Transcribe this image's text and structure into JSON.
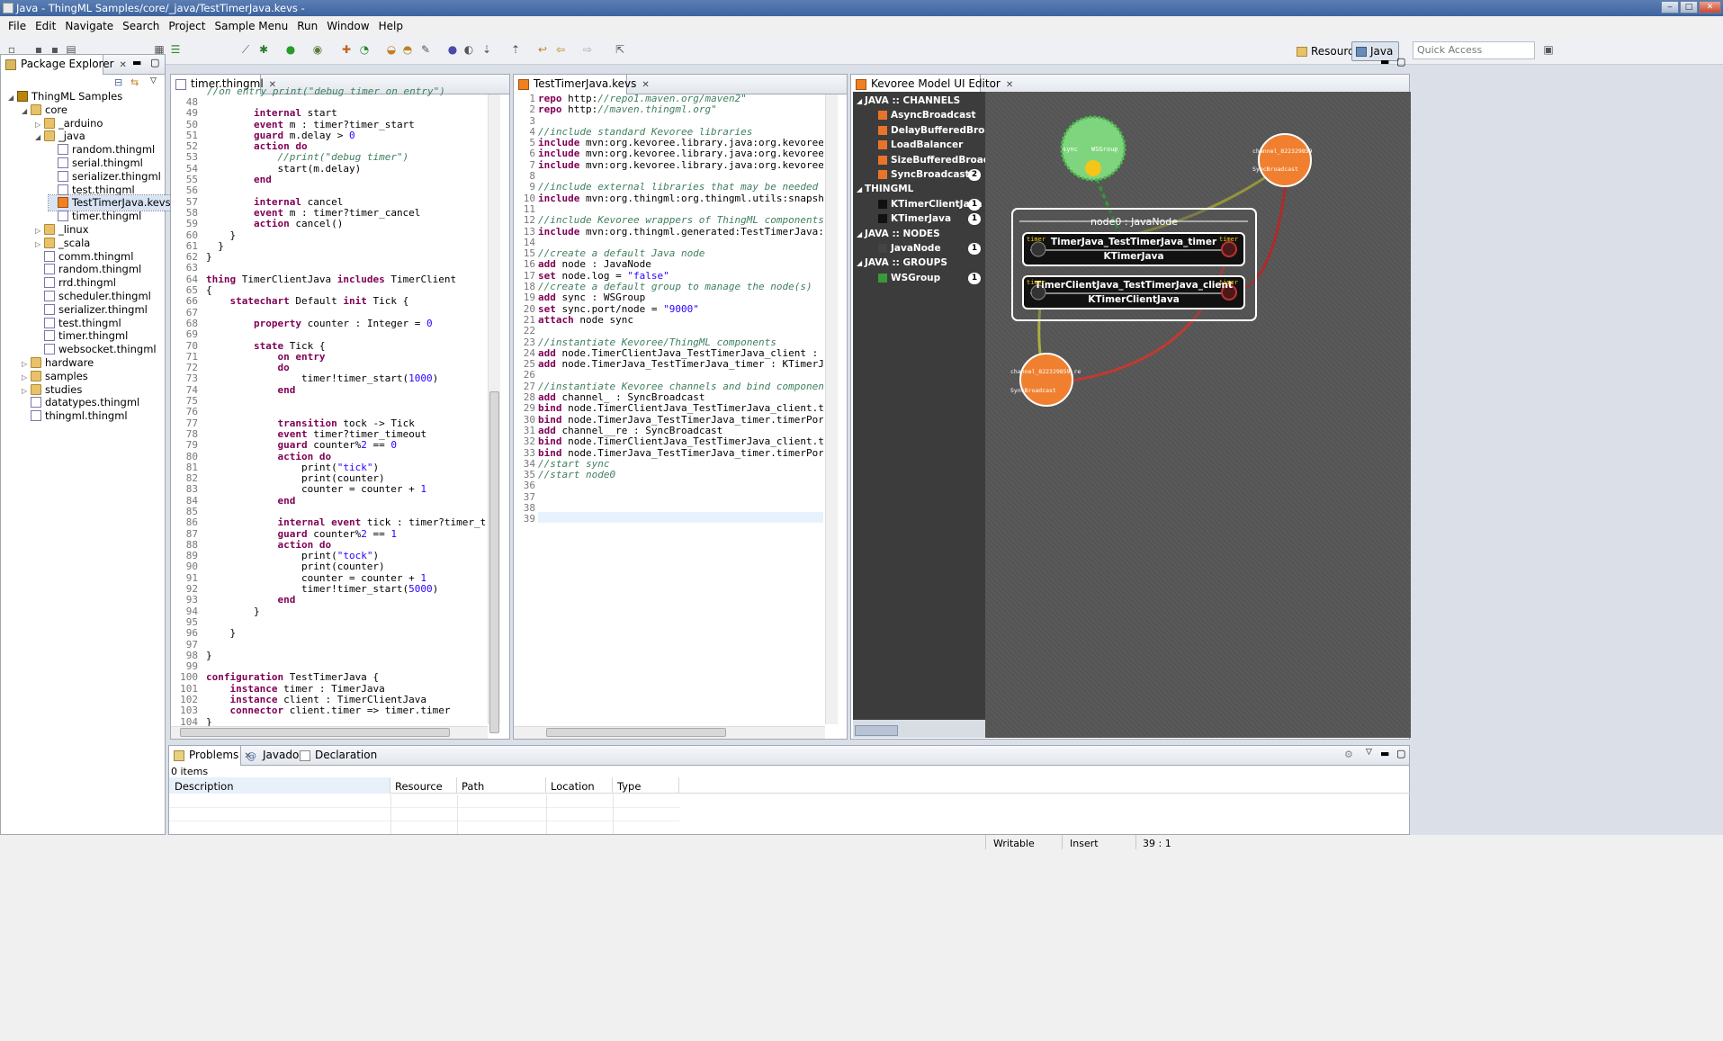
{
  "window": {
    "title": "Java - ThingML Samples/core/_java/TestTimerJava.kevs -"
  },
  "menu": [
    "File",
    "Edit",
    "Navigate",
    "Search",
    "Project",
    "Sample Menu",
    "Run",
    "Window",
    "Help"
  ],
  "toolbar": {
    "quick_access_placeholder": "Quick Access",
    "perspective_resource": "Resource",
    "perspective_java": "Java"
  },
  "package_explorer": {
    "tab_label": "Package Explorer",
    "items": [
      {
        "label": "ThingML Samples",
        "depth": 0,
        "icon": "project-icon",
        "arrow": "◢"
      },
      {
        "label": "core",
        "depth": 1,
        "icon": "folder-icon",
        "arrow": "◢"
      },
      {
        "label": "_arduino",
        "depth": 2,
        "icon": "folder-icon",
        "arrow": "▷"
      },
      {
        "label": "_java",
        "depth": 2,
        "icon": "folder-icon",
        "arrow": "◢"
      },
      {
        "label": "random.thingml",
        "depth": 3,
        "icon": "file-icon",
        "arrow": ""
      },
      {
        "label": "serial.thingml",
        "depth": 3,
        "icon": "file-icon",
        "arrow": ""
      },
      {
        "label": "serializer.thingml",
        "depth": 3,
        "icon": "file-icon",
        "arrow": ""
      },
      {
        "label": "test.thingml",
        "depth": 3,
        "icon": "file-icon",
        "arrow": ""
      },
      {
        "label": "TestTimerJava.kevs",
        "depth": 3,
        "icon": "kevs-icon",
        "arrow": ""
      },
      {
        "label": "timer.thingml",
        "depth": 3,
        "icon": "file-icon",
        "arrow": ""
      },
      {
        "label": "_linux",
        "depth": 2,
        "icon": "folder-icon",
        "arrow": "▷"
      },
      {
        "label": "_scala",
        "depth": 2,
        "icon": "folder-icon",
        "arrow": "▷"
      },
      {
        "label": "comm.thingml",
        "depth": 2,
        "icon": "file-icon",
        "arrow": ""
      },
      {
        "label": "random.thingml",
        "depth": 2,
        "icon": "file-icon",
        "arrow": ""
      },
      {
        "label": "rrd.thingml",
        "depth": 2,
        "icon": "file-icon",
        "arrow": ""
      },
      {
        "label": "scheduler.thingml",
        "depth": 2,
        "icon": "file-icon",
        "arrow": ""
      },
      {
        "label": "serializer.thingml",
        "depth": 2,
        "icon": "file-icon",
        "arrow": ""
      },
      {
        "label": "test.thingml",
        "depth": 2,
        "icon": "file-icon",
        "arrow": ""
      },
      {
        "label": "timer.thingml",
        "depth": 2,
        "icon": "file-icon",
        "arrow": ""
      },
      {
        "label": "websocket.thingml",
        "depth": 2,
        "icon": "file-icon",
        "arrow": ""
      },
      {
        "label": "hardware",
        "depth": 1,
        "icon": "folder-icon",
        "arrow": "▷"
      },
      {
        "label": "samples",
        "depth": 1,
        "icon": "folder-icon",
        "arrow": "▷"
      },
      {
        "label": "studies",
        "depth": 1,
        "icon": "folder-icon",
        "arrow": "▷"
      },
      {
        "label": "datatypes.thingml",
        "depth": 1,
        "icon": "file-icon",
        "arrow": ""
      },
      {
        "label": "thingml.thingml",
        "depth": 1,
        "icon": "file-icon",
        "arrow": ""
      }
    ]
  },
  "editor1": {
    "tab_label": "timer.thingml",
    "first_line_partial": "//on entry print(\"debug timer on entry\")",
    "line_numbers": [
      "48",
      "49",
      "50",
      "51",
      "52",
      "53",
      "54",
      "55",
      "56",
      "57",
      "58",
      "59",
      "60",
      "61",
      "62",
      "63",
      "64",
      "65",
      "66",
      "67",
      "68",
      "69",
      "70",
      "71",
      "72",
      "73",
      "74",
      "75",
      "76",
      "77",
      "78",
      "79",
      "80",
      "81",
      "82",
      "83",
      "84",
      "85",
      "86",
      "87",
      "88",
      "89",
      "90",
      "91",
      "92",
      "93",
      "94",
      "95",
      "96",
      "97",
      "98",
      "99",
      "100",
      "101",
      "102",
      "103",
      "104"
    ],
    "lines": [
      "",
      "        internal start",
      "        event m : timer?timer_start",
      "        guard m.delay > 0",
      "        action do",
      "            //print(\"debug timer\")",
      "            start(m.delay)",
      "        end",
      "",
      "        internal cancel",
      "        event m : timer?timer_cancel",
      "        action cancel()",
      "    }",
      "  }",
      "}",
      "",
      "thing TimerClientJava includes TimerClient",
      "{",
      "    statechart Default init Tick {",
      "",
      "        property counter : Integer = 0",
      "",
      "        state Tick {",
      "            on entry",
      "            do",
      "                timer!timer_start(1000)",
      "            end",
      "",
      "",
      "            transition tock -> Tick",
      "            event timer?timer_timeout",
      "            guard counter%2 == 0",
      "            action do",
      "                print(\"tick\")",
      "                print(counter)",
      "                counter = counter + 1",
      "            end",
      "",
      "            internal event tick : timer?timer_timeout",
      "            guard counter%2 == 1",
      "            action do",
      "                print(\"tock\")",
      "                print(counter)",
      "                counter = counter + 1",
      "                timer!timer_start(5000)",
      "            end",
      "        }",
      "",
      "    }",
      "",
      "}",
      "",
      "configuration TestTimerJava {",
      "    instance timer : TimerJava",
      "    instance client : TimerClientJava",
      "    connector client.timer => timer.timer",
      "}"
    ]
  },
  "editor2": {
    "tab_label": "TestTimerJava.kevs",
    "line_numbers": [
      "1",
      "2",
      "3",
      "4",
      "5",
      "6",
      "7",
      "8",
      "9",
      "10",
      "11",
      "12",
      "13",
      "14",
      "15",
      "16",
      "17",
      "18",
      "19",
      "20",
      "21",
      "22",
      "23",
      "24",
      "25",
      "26",
      "27",
      "28",
      "29",
      "30",
      "31",
      "32",
      "33",
      "34",
      "35",
      "36",
      "37",
      "38",
      "39"
    ],
    "lines": [
      "repo \"http://repo1.maven.org/maven2\"",
      "repo \"http://maven.thingml.org\"",
      "",
      "//include standard Kevoree libraries",
      "include mvn:org.kevoree.library.java:org.kevoree.library",
      "include mvn:org.kevoree.library.java:org.kevoree.library",
      "include mvn:org.kevoree.library.java:org.kevoree.library",
      "",
      "//include external libraries that may be needed by Thing",
      "include mvn:org.thingml:org.thingml.utils:snapshot",
      "",
      "//include Kevoree wrappers of ThingML components",
      "include mvn:org.thingml.generated:TestTimerJava:1.0-SNAP",
      "",
      "//create a default Java node",
      "add node0 : JavaNode",
      "set node0.log = \"false\"",
      "//create a default group to manage the node(s)",
      "add sync : WSGroup",
      "set sync.port/node0 = \"9000\"",
      "attach node0 sync",
      "",
      "//instantiate Kevoree/ThingML components",
      "add node0.TimerClientJava_TestTimerJava_client : KTimerC",
      "add node0.TimerJava_TestTimerJava_timer : KTimerJava",
      "",
      "//instantiate Kevoree channels and bind component",
      "add channel_822329859 : SyncBroadcast",
      "bind node0.TimerClientJava_TestTimerJava_client.timerPor",
      "bind node0.TimerJava_TestTimerJava_timer.timerPort chann",
      "add channel_822329859_re : SyncBroadcast",
      "bind node0.TimerClientJava_TestTimerJava_client.timerPor",
      "bind node0.TimerJava_TestTimerJava_timer.timerPort_out c",
      "//start sync",
      "//start node0",
      "",
      "",
      "",
      ""
    ]
  },
  "kevoree": {
    "tab_label": "Kevoree Model UI Editor",
    "groups": [
      {
        "header": "JAVA :: CHANNELS",
        "items": [
          {
            "label": "AsyncBroadcast",
            "color": "#e8742a",
            "badge": ""
          },
          {
            "label": "DelayBufferedBroad...",
            "color": "#e8742a",
            "badge": ""
          },
          {
            "label": "LoadBalancer",
            "color": "#e8742a",
            "badge": ""
          },
          {
            "label": "SizeBufferedBroadc...",
            "color": "#e8742a",
            "badge": ""
          },
          {
            "label": "SyncBroadcast",
            "color": "#e8742a",
            "badge": "2"
          }
        ]
      },
      {
        "header": "THINGML",
        "items": [
          {
            "label": "KTimerClientJava",
            "color": "#111111",
            "badge": "1"
          },
          {
            "label": "KTimerJava",
            "color": "#111111",
            "badge": "1"
          }
        ]
      },
      {
        "header": "JAVA :: NODES",
        "items": [
          {
            "label": "JavaNode",
            "color": "#444444",
            "badge": "1"
          }
        ]
      },
      {
        "header": "JAVA :: GROUPS",
        "items": [
          {
            "label": "WSGroup",
            "color": "#3a9a3a",
            "badge": "1"
          }
        ]
      }
    ],
    "canvas": {
      "group_label_sync": "sync",
      "group_label_type": "WSGroup",
      "node_title": "node0 : JavaNode",
      "comp1_name": "TimerJava_TestTimerJava_timer",
      "comp1_type": "KTimerJava",
      "comp2_name": "TimerClientJava_TestTimerJava_client",
      "comp2_type": "KTimerClientJava",
      "port_label": "timer",
      "chan1_name": "channel_822329859",
      "chan1_type": "SyncBroadcast",
      "chan2_name": "channel_822329859_re",
      "chan2_type": "SyncBroadcast"
    }
  },
  "problems": {
    "tabs": [
      "Problems",
      "Javadoc",
      "Declaration"
    ],
    "count": "0 items",
    "columns": [
      "Description",
      "Resource",
      "Path",
      "Location",
      "Type"
    ]
  },
  "status": {
    "writable": "Writable",
    "insert": "Insert",
    "position": "39 : 1"
  }
}
